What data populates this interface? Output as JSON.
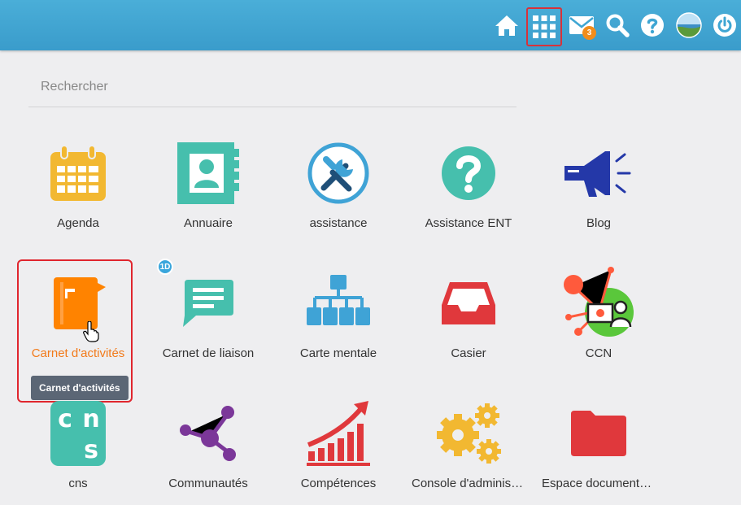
{
  "header": {
    "icons": [
      "home-icon",
      "apps-grid-icon",
      "mail-icon",
      "search-icon",
      "help-icon",
      "avatar",
      "power-icon"
    ],
    "mail_badge": "3"
  },
  "search": {
    "placeholder": "Rechercher"
  },
  "apps": [
    {
      "label": "Agenda",
      "icon": "calendar-icon"
    },
    {
      "label": "Annuaire",
      "icon": "contact-book-icon"
    },
    {
      "label": "assistance",
      "icon": "tools-icon"
    },
    {
      "label": "Assistance ENT",
      "icon": "question-icon"
    },
    {
      "label": "Blog",
      "icon": "megaphone-icon"
    },
    {
      "label": "Carnet d'activités",
      "icon": "notebook-icon"
    },
    {
      "label": "Carnet de liaison",
      "icon": "message-icon"
    },
    {
      "label": "Carte mentale",
      "icon": "mindmap-icon"
    },
    {
      "label": "Casier",
      "icon": "inbox-tray-icon"
    },
    {
      "label": "CCN",
      "icon": "ccn-network-icon"
    },
    {
      "label": "cns",
      "icon": "cns-icon"
    },
    {
      "label": "Communautés",
      "icon": "share-nodes-icon"
    },
    {
      "label": "Compétences",
      "icon": "growth-chart-icon"
    },
    {
      "label": "Console d'administration",
      "icon": "gears-icon"
    },
    {
      "label": "Espace documentaire",
      "icon": "folder-icon"
    }
  ],
  "badge_1d": "1D",
  "tooltip": "Carnet d'activités",
  "cns_letters": [
    "c",
    "n",
    "s"
  ],
  "colors": {
    "topbar": "#3fa6d3",
    "agenda": "#f2b831",
    "teal": "#46bfad",
    "assistance": "#3fa3d6",
    "blog": "#2438a8",
    "carnet_activites": "#ff8300",
    "casier": "#e0383c",
    "communautes": "#7b3799",
    "competences": "#e0383c",
    "console": "#f2b831",
    "espace": "#e0383c",
    "selection": "#e0262e",
    "selected_label": "#f27a1a"
  }
}
